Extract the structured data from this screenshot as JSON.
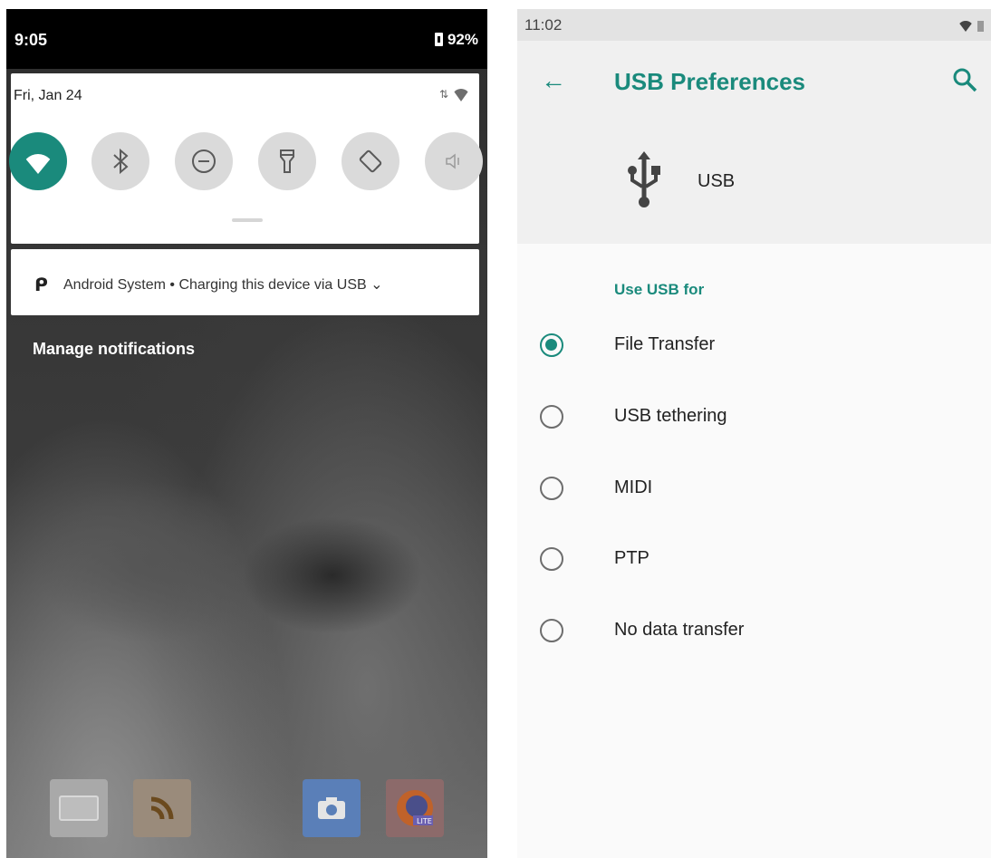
{
  "left": {
    "status_time": "9:05",
    "battery": "92%",
    "date": "Fri, Jan 24",
    "tiles": [
      "wifi-icon",
      "bluetooth-icon",
      "do-not-disturb-icon",
      "flashlight-icon",
      "auto-rotate-icon",
      "volume-icon"
    ],
    "notification": {
      "app": "Android System",
      "separator": "•",
      "text": "Charging this device via USB"
    },
    "manage_notifications": "Manage notifications"
  },
  "right": {
    "status_time": "11:02",
    "title": "USB Preferences",
    "usb_label": "USB",
    "section": "Use USB for",
    "options": [
      {
        "label": "File Transfer",
        "selected": true
      },
      {
        "label": "USB tethering",
        "selected": false
      },
      {
        "label": "MIDI",
        "selected": false
      },
      {
        "label": "PTP",
        "selected": false
      },
      {
        "label": "No data transfer",
        "selected": false
      }
    ]
  },
  "colors": {
    "accent": "#1a8a7c",
    "statusbar_dark": "#000000",
    "surface": "#fafafa"
  }
}
